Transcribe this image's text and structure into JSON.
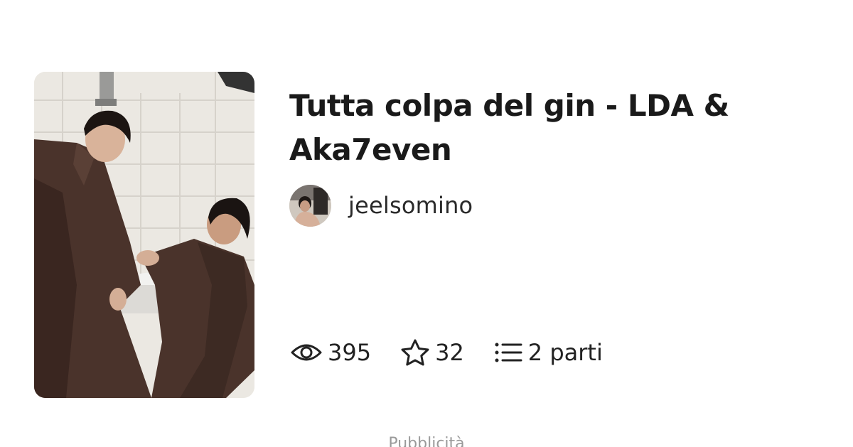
{
  "story": {
    "title": "Tutta colpa del gin - LDA & Aka7even",
    "author": "jeelsomino",
    "cover_icon": "book-cover-photo",
    "avatar_icon": "user-avatar-photo"
  },
  "stats": {
    "reads": "395",
    "reads_icon": "eye-icon",
    "votes": "32",
    "votes_icon": "star-icon",
    "parts": "2 parti",
    "parts_icon": "list-icon"
  },
  "ad": {
    "label": "Pubblicità"
  },
  "colors": {
    "text": "#1a1a1a",
    "muted": "#9a9a9a",
    "divider": "#cfcfcf"
  }
}
